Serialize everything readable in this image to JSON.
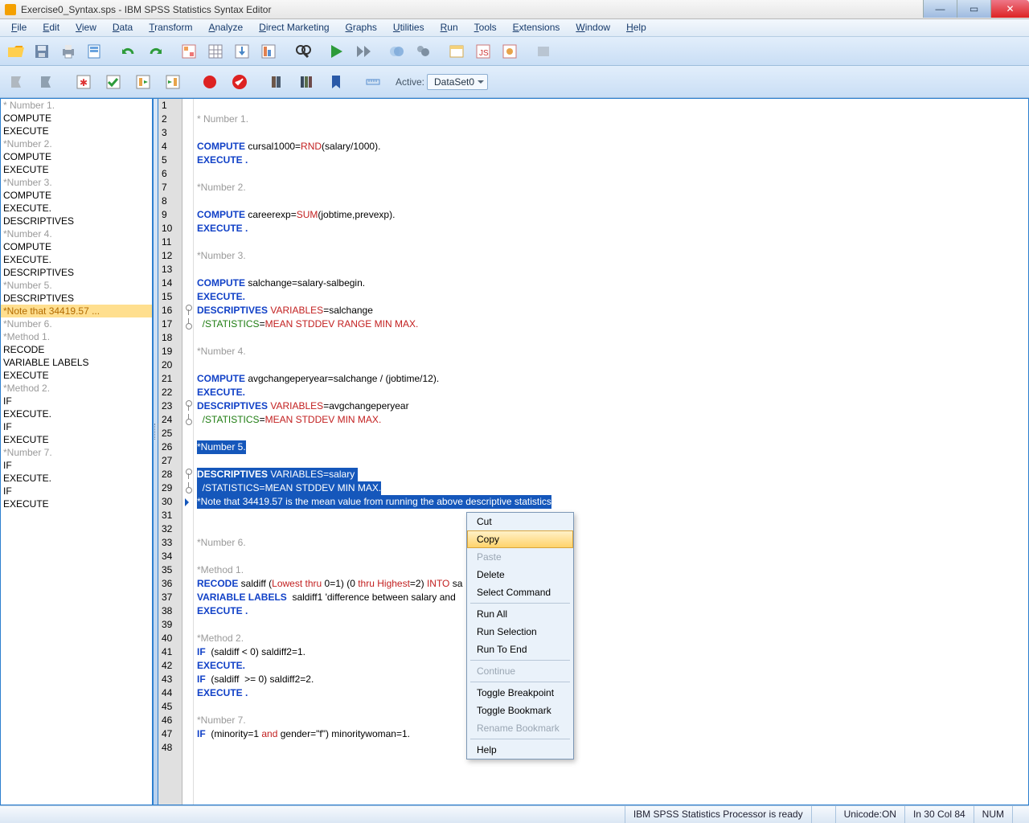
{
  "title": "Exercise0_Syntax.sps - IBM SPSS Statistics Syntax Editor",
  "menus": [
    "File",
    "Edit",
    "View",
    "Data",
    "Transform",
    "Analyze",
    "Direct Marketing",
    "Graphs",
    "Utilities",
    "Run",
    "Tools",
    "Extensions",
    "Window",
    "Help"
  ],
  "activeLabel": "Active:",
  "activeDataset": "DataSet0",
  "nav": [
    {
      "t": "* Number 1.",
      "dim": true
    },
    {
      "t": "COMPUTE"
    },
    {
      "t": "EXECUTE"
    },
    {
      "t": "*Number 2.",
      "dim": true
    },
    {
      "t": "COMPUTE"
    },
    {
      "t": "EXECUTE"
    },
    {
      "t": "*Number 3.",
      "dim": true
    },
    {
      "t": "COMPUTE"
    },
    {
      "t": "EXECUTE."
    },
    {
      "t": "DESCRIPTIVES"
    },
    {
      "t": "*Number 4.",
      "dim": true
    },
    {
      "t": "COMPUTE"
    },
    {
      "t": "EXECUTE."
    },
    {
      "t": "DESCRIPTIVES"
    },
    {
      "t": "*Number 5.",
      "dim": true
    },
    {
      "t": "DESCRIPTIVES"
    },
    {
      "t": "*Note that 34419.57 ...",
      "sel": true
    },
    {
      "t": "*Number 6.",
      "dim": true
    },
    {
      "t": "*Method 1.",
      "dim": true
    },
    {
      "t": "RECODE"
    },
    {
      "t": "VARIABLE LABELS"
    },
    {
      "t": "EXECUTE"
    },
    {
      "t": "*Method 2.",
      "dim": true
    },
    {
      "t": "IF"
    },
    {
      "t": "EXECUTE."
    },
    {
      "t": "IF"
    },
    {
      "t": "EXECUTE"
    },
    {
      "t": "*Number 7.",
      "dim": true
    },
    {
      "t": "IF"
    },
    {
      "t": "EXECUTE."
    },
    {
      "t": "IF"
    },
    {
      "t": "EXECUTE"
    }
  ],
  "lines": [
    {
      "n": 1,
      "seg": []
    },
    {
      "n": 2,
      "seg": [
        [
          "cm",
          "* Number 1."
        ]
      ]
    },
    {
      "n": 3,
      "seg": []
    },
    {
      "n": 4,
      "seg": [
        [
          "kw",
          "COMPUTE"
        ],
        [
          "",
          " cursal1000="
        ],
        [
          "fn",
          "RND"
        ],
        [
          "",
          "(salary/1000)."
        ]
      ]
    },
    {
      "n": 5,
      "seg": [
        [
          "kw",
          "EXECUTE ."
        ]
      ]
    },
    {
      "n": 6,
      "seg": []
    },
    {
      "n": 7,
      "seg": [
        [
          "cm",
          "*Number 2."
        ]
      ]
    },
    {
      "n": 8,
      "seg": []
    },
    {
      "n": 9,
      "seg": [
        [
          "kw",
          "COMPUTE"
        ],
        [
          "",
          " careerexp="
        ],
        [
          "fn",
          "SUM"
        ],
        [
          "",
          "(jobtime,prevexp)."
        ]
      ]
    },
    {
      "n": 10,
      "seg": [
        [
          "kw",
          "EXECUTE ."
        ]
      ]
    },
    {
      "n": 11,
      "seg": []
    },
    {
      "n": 12,
      "seg": [
        [
          "cm",
          "*Number 3."
        ]
      ]
    },
    {
      "n": 13,
      "seg": []
    },
    {
      "n": 14,
      "seg": [
        [
          "kw",
          "COMPUTE"
        ],
        [
          "",
          " salchange=salary-salbegin."
        ]
      ]
    },
    {
      "n": 15,
      "seg": [
        [
          "kw",
          "EXECUTE."
        ]
      ]
    },
    {
      "n": 16,
      "seg": [
        [
          "kw",
          "DESCRIPTIVES"
        ],
        [
          " ",
          " "
        ],
        [
          "fn",
          "VARIABLES"
        ],
        [
          "",
          "=salchange"
        ]
      ],
      "m": "s"
    },
    {
      "n": 17,
      "seg": [
        [
          "",
          "  "
        ],
        [
          "op",
          "/STATISTICS"
        ],
        [
          "",
          "="
        ],
        [
          "fn",
          "MEAN STDDEV RANGE MIN MAX."
        ]
      ],
      "m": "e"
    },
    {
      "n": 18,
      "seg": []
    },
    {
      "n": 19,
      "seg": [
        [
          "cm",
          "*Number 4."
        ]
      ]
    },
    {
      "n": 20,
      "seg": []
    },
    {
      "n": 21,
      "seg": [
        [
          "kw",
          "COMPUTE"
        ],
        [
          "",
          " avgchangeperyear=salchange / (jobtime/12)."
        ]
      ]
    },
    {
      "n": 22,
      "seg": [
        [
          "kw",
          "EXECUTE."
        ]
      ]
    },
    {
      "n": 23,
      "seg": [
        [
          "kw",
          "DESCRIPTIVES"
        ],
        [
          " ",
          " "
        ],
        [
          "fn",
          "VARIABLES"
        ],
        [
          "",
          "=avgchangeperyear"
        ]
      ],
      "m": "s"
    },
    {
      "n": 24,
      "seg": [
        [
          "",
          "  "
        ],
        [
          "op",
          "/STATISTICS"
        ],
        [
          "",
          "="
        ],
        [
          "fn",
          "MEAN STDDEV MIN MAX."
        ]
      ],
      "m": "e"
    },
    {
      "n": 25,
      "seg": []
    },
    {
      "n": 26,
      "sel": true,
      "seg": [
        [
          "cm",
          "*Number 5."
        ]
      ]
    },
    {
      "n": 27,
      "sel": true,
      "seg": [
        [
          "",
          ""
        ]
      ]
    },
    {
      "n": 28,
      "sel": true,
      "seg": [
        [
          "kw",
          "DESCRIPTIVES"
        ],
        [
          "",
          " VARIABLES=salary "
        ]
      ],
      "m": "s"
    },
    {
      "n": 29,
      "sel": true,
      "seg": [
        [
          "",
          "  /STATISTICS=MEAN STDDEV MIN MAX."
        ]
      ],
      "m": "e"
    },
    {
      "n": 30,
      "sel": true,
      "tri": true,
      "seg": [
        [
          "cm",
          "*Note that 34419.57 is the mean value from running the above descriptive statistics"
        ]
      ]
    },
    {
      "n": 31,
      "seg": []
    },
    {
      "n": 32,
      "seg": []
    },
    {
      "n": 33,
      "seg": [
        [
          "cm",
          "*Number 6."
        ]
      ]
    },
    {
      "n": 34,
      "seg": []
    },
    {
      "n": 35,
      "seg": [
        [
          "cm",
          "*Method 1."
        ]
      ]
    },
    {
      "n": 36,
      "seg": [
        [
          "kw",
          "RECODE"
        ],
        [
          "",
          " saldiff ("
        ],
        [
          "fn",
          "Lowest thru"
        ],
        [
          "",
          " 0=1) (0 "
        ],
        [
          "fn",
          "thru Highest"
        ],
        [
          "",
          "=2) "
        ],
        [
          "fn",
          "INTO"
        ],
        [
          "",
          " sa"
        ]
      ]
    },
    {
      "n": 37,
      "seg": [
        [
          "kw",
          "VARIABLE LABELS"
        ],
        [
          "",
          "  saldiff1 'difference between salary and"
        ]
      ]
    },
    {
      "n": 38,
      "seg": [
        [
          "kw",
          "EXECUTE ."
        ]
      ]
    },
    {
      "n": 39,
      "seg": []
    },
    {
      "n": 40,
      "seg": [
        [
          "cm",
          "*Method 2."
        ]
      ]
    },
    {
      "n": 41,
      "seg": [
        [
          "kw",
          "IF"
        ],
        [
          "",
          "  (saldiff < 0) saldiff2=1."
        ]
      ]
    },
    {
      "n": 42,
      "seg": [
        [
          "kw",
          "EXECUTE."
        ]
      ]
    },
    {
      "n": 43,
      "seg": [
        [
          "kw",
          "IF"
        ],
        [
          "",
          "  (saldiff  >= 0) saldiff2=2."
        ]
      ]
    },
    {
      "n": 44,
      "seg": [
        [
          "kw",
          "EXECUTE ."
        ]
      ]
    },
    {
      "n": 45,
      "seg": []
    },
    {
      "n": 46,
      "seg": [
        [
          "cm",
          "*Number 7."
        ]
      ]
    },
    {
      "n": 47,
      "seg": [
        [
          "kw",
          "IF"
        ],
        [
          "",
          "  (minority=1 "
        ],
        [
          "fn",
          "and"
        ],
        [
          "",
          " gender=\"f\") minoritywoman=1."
        ]
      ]
    },
    {
      "n": 48,
      "seg": []
    }
  ],
  "ctx": [
    {
      "t": "Cut"
    },
    {
      "t": "Copy",
      "hov": true
    },
    {
      "t": "Paste",
      "dis": true
    },
    {
      "t": "Delete"
    },
    {
      "t": "Select Command"
    },
    {
      "sep": true
    },
    {
      "t": "Run All"
    },
    {
      "t": "Run Selection"
    },
    {
      "t": "Run To End"
    },
    {
      "sep": true
    },
    {
      "t": "Continue",
      "dis": true
    },
    {
      "sep": true
    },
    {
      "t": "Toggle Breakpoint"
    },
    {
      "t": "Toggle Bookmark"
    },
    {
      "t": "Rename Bookmark",
      "dis": true
    },
    {
      "sep": true
    },
    {
      "t": "Help"
    }
  ],
  "status": {
    "proc": "IBM SPSS Statistics Processor is ready",
    "uni": "Unicode:ON",
    "pos": "In 30 Col 84",
    "num": "NUM"
  },
  "toolbarIcons1": [
    "open",
    "save",
    "print",
    "preview",
    "",
    "undo",
    "redo",
    "",
    "chart",
    "table",
    "download",
    "report",
    "",
    "find",
    "",
    "run",
    "skip",
    "",
    "venn",
    "shapes",
    "",
    "dialog",
    "js",
    "media",
    "",
    "output"
  ],
  "toolbarIcons2": [
    "bp-off",
    "bp-on",
    "",
    "star",
    "tick",
    "step",
    "step2",
    "",
    "rec",
    "ok",
    "",
    "book",
    "books",
    "bookmk",
    "",
    "ruler"
  ]
}
